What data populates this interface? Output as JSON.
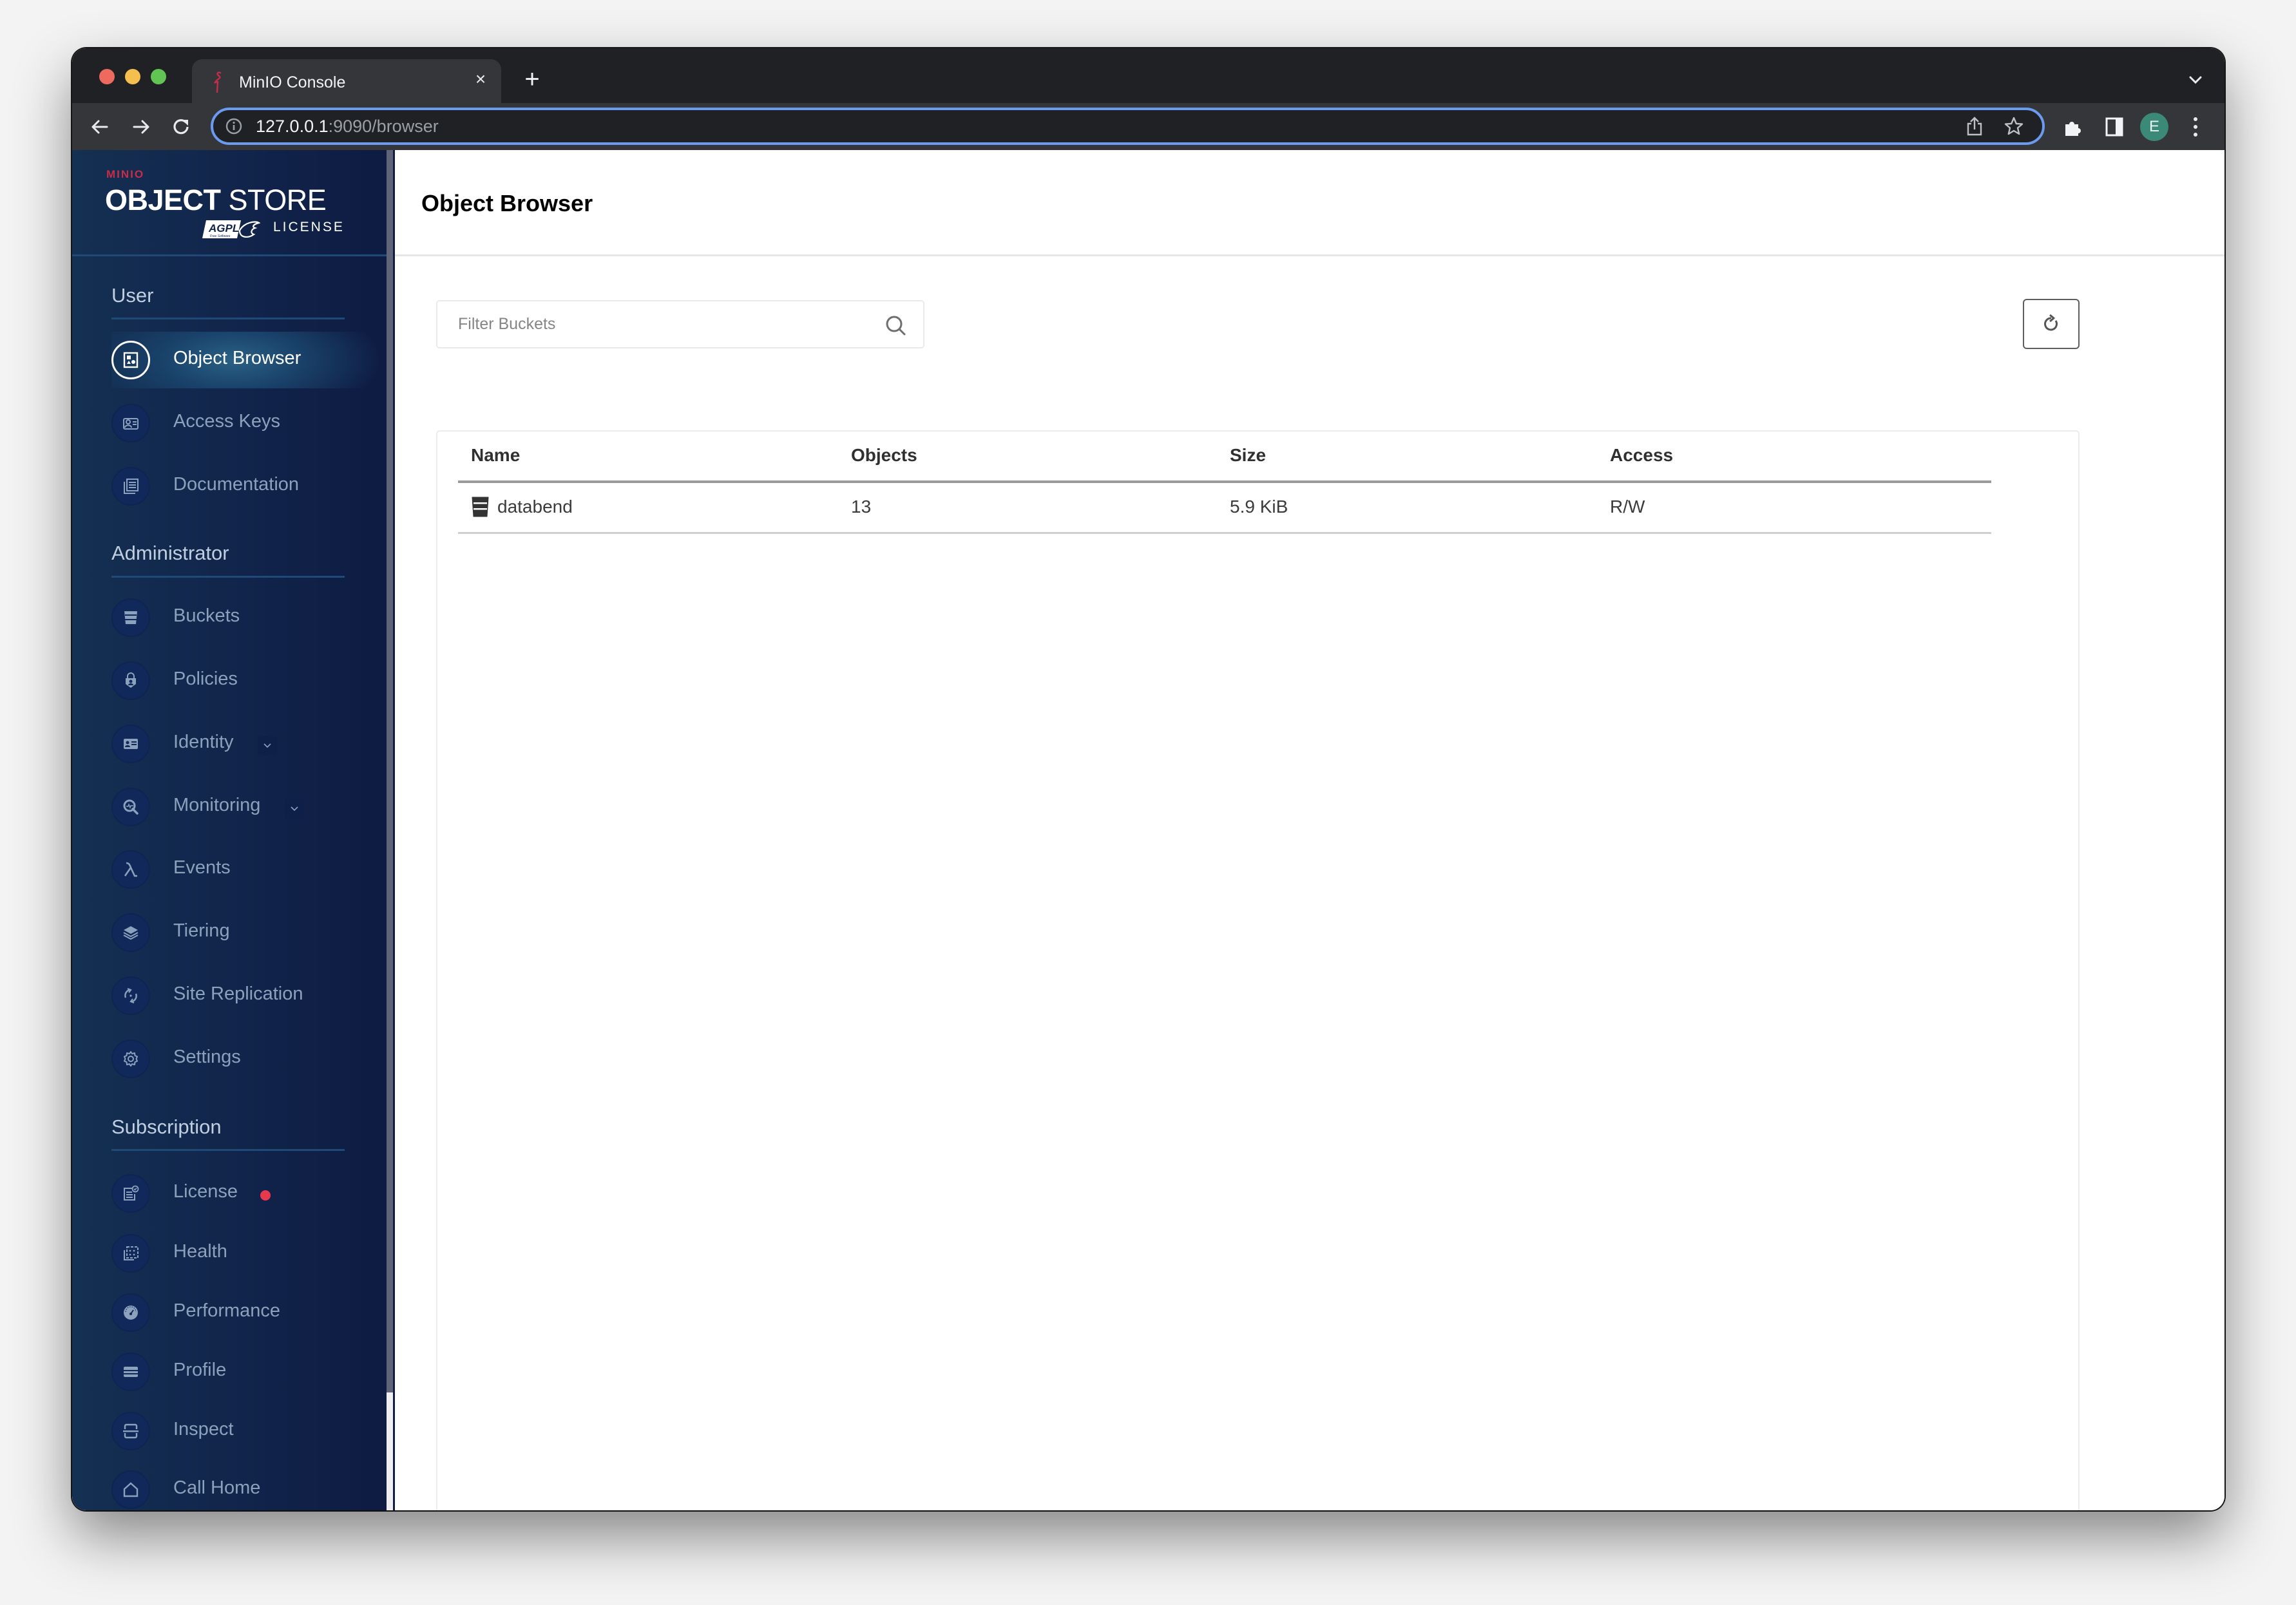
{
  "browser": {
    "tab_title": "MinIO Console",
    "tab_close": "×",
    "new_tab": "+",
    "url_host": "127.0.0.1",
    "url_rest": ":9090/browser",
    "profile_initial": "E",
    "profile_color": "#3a8a77"
  },
  "sidebar": {
    "logo": {
      "brand": "MINIO",
      "product_bold": "OBJECT",
      "product_light": "STORE",
      "badge": "AGPL v3",
      "license": "LICENSE"
    },
    "sections": [
      {
        "title": "User",
        "items": [
          {
            "label": "Object Browser",
            "icon": "object-browser-icon",
            "active": true
          },
          {
            "label": "Access Keys",
            "icon": "access-keys-icon"
          },
          {
            "label": "Documentation",
            "icon": "documentation-icon"
          }
        ]
      },
      {
        "title": "Administrator",
        "items": [
          {
            "label": "Buckets",
            "icon": "bucket-icon"
          },
          {
            "label": "Policies",
            "icon": "policy-shield-icon"
          },
          {
            "label": "Identity",
            "icon": "identity-card-icon",
            "expandable": true
          },
          {
            "label": "Monitoring",
            "icon": "monitoring-search-icon",
            "expandable": true
          },
          {
            "label": "Events",
            "icon": "lambda-icon"
          },
          {
            "label": "Tiering",
            "icon": "layers-icon"
          },
          {
            "label": "Site Replication",
            "icon": "replication-icon"
          },
          {
            "label": "Settings",
            "icon": "gear-icon"
          }
        ]
      },
      {
        "title": "Subscription",
        "items": [
          {
            "label": "License",
            "icon": "license-icon",
            "badge": "alert-dot"
          },
          {
            "label": "Health",
            "icon": "health-icon"
          },
          {
            "label": "Performance",
            "icon": "speedometer-icon"
          },
          {
            "label": "Profile",
            "icon": "profile-icon"
          },
          {
            "label": "Inspect",
            "icon": "inspect-icon"
          },
          {
            "label": "Call Home",
            "icon": "call-home-icon"
          }
        ]
      }
    ],
    "colors": {
      "alert_dot": "#e8384f",
      "brand_red": "#c72c48"
    }
  },
  "main": {
    "title": "Object Browser",
    "filter_placeholder": "Filter Buckets",
    "filter_value": "",
    "table": {
      "columns": [
        "Name",
        "Objects",
        "Size",
        "Access"
      ],
      "rows": [
        {
          "name": "databend",
          "objects": "13",
          "size": "5.9 KiB",
          "access": "R/W"
        }
      ]
    }
  }
}
